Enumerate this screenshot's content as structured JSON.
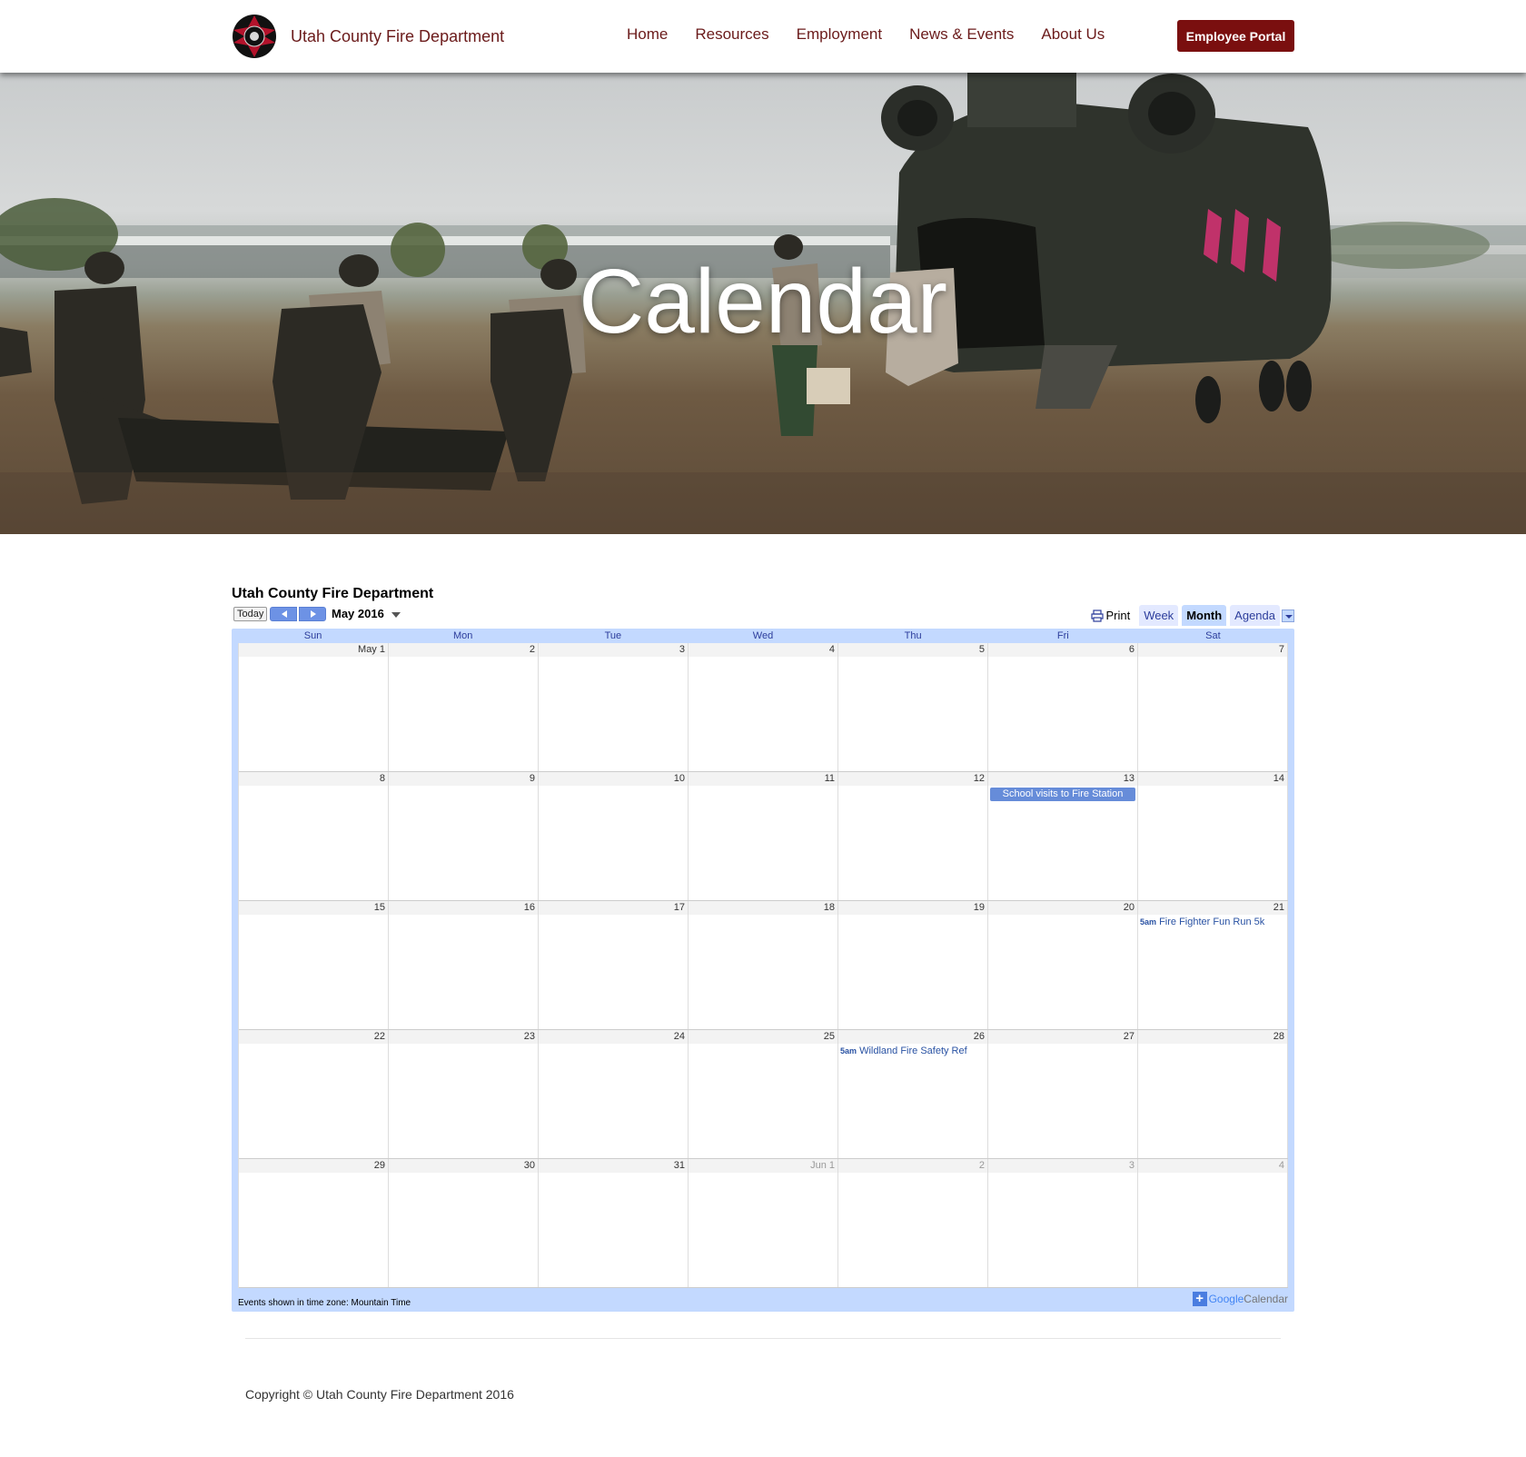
{
  "header": {
    "brand": "Utah County Fire Department",
    "nav": [
      "Home",
      "Resources",
      "Employment",
      "News & Events",
      "About Us"
    ],
    "portal_button": "Employee Portal"
  },
  "hero": {
    "title": "Calendar"
  },
  "calendar": {
    "title": "Utah County Fire Department",
    "today_label": "Today",
    "month_label": "May 2016",
    "print_label": "Print",
    "views": [
      "Week",
      "Month",
      "Agenda"
    ],
    "active_view": "Month",
    "days_of_week": [
      "Sun",
      "Mon",
      "Tue",
      "Wed",
      "Thu",
      "Fri",
      "Sat"
    ],
    "weeks": [
      [
        {
          "d": "May 1"
        },
        {
          "d": "2"
        },
        {
          "d": "3"
        },
        {
          "d": "4"
        },
        {
          "d": "5"
        },
        {
          "d": "6"
        },
        {
          "d": "7"
        }
      ],
      [
        {
          "d": "8"
        },
        {
          "d": "9"
        },
        {
          "d": "10"
        },
        {
          "d": "11"
        },
        {
          "d": "12"
        },
        {
          "d": "13",
          "event": {
            "type": "allday",
            "title": "School visits to Fire Station"
          }
        },
        {
          "d": "14"
        }
      ],
      [
        {
          "d": "15"
        },
        {
          "d": "16"
        },
        {
          "d": "17"
        },
        {
          "d": "18"
        },
        {
          "d": "19"
        },
        {
          "d": "20"
        },
        {
          "d": "21",
          "event": {
            "type": "timed",
            "time": "5am",
            "title": "Fire Fighter Fun Run 5k"
          }
        }
      ],
      [
        {
          "d": "22"
        },
        {
          "d": "23"
        },
        {
          "d": "24"
        },
        {
          "d": "25"
        },
        {
          "d": "26",
          "event": {
            "type": "timed",
            "time": "5am",
            "title": "Wildland Fire Safety Ref"
          }
        },
        {
          "d": "27"
        },
        {
          "d": "28"
        }
      ],
      [
        {
          "d": "29"
        },
        {
          "d": "30"
        },
        {
          "d": "31"
        },
        {
          "d": "Jun 1",
          "other": true
        },
        {
          "d": "2",
          "other": true
        },
        {
          "d": "3",
          "other": true
        },
        {
          "d": "4",
          "other": true
        }
      ]
    ],
    "timezone_note": "Events shown in time zone: Mountain Time",
    "google_calendar": {
      "google": "Google",
      "calendar": "Calendar"
    }
  },
  "footer": {
    "copyright": "Copyright © Utah County Fire Department 2016"
  },
  "colors": {
    "brand": "#6b1b1b",
    "portal": "#7a0f0f",
    "cal_accent": "#c3d9ff",
    "event": "#668cd9"
  }
}
